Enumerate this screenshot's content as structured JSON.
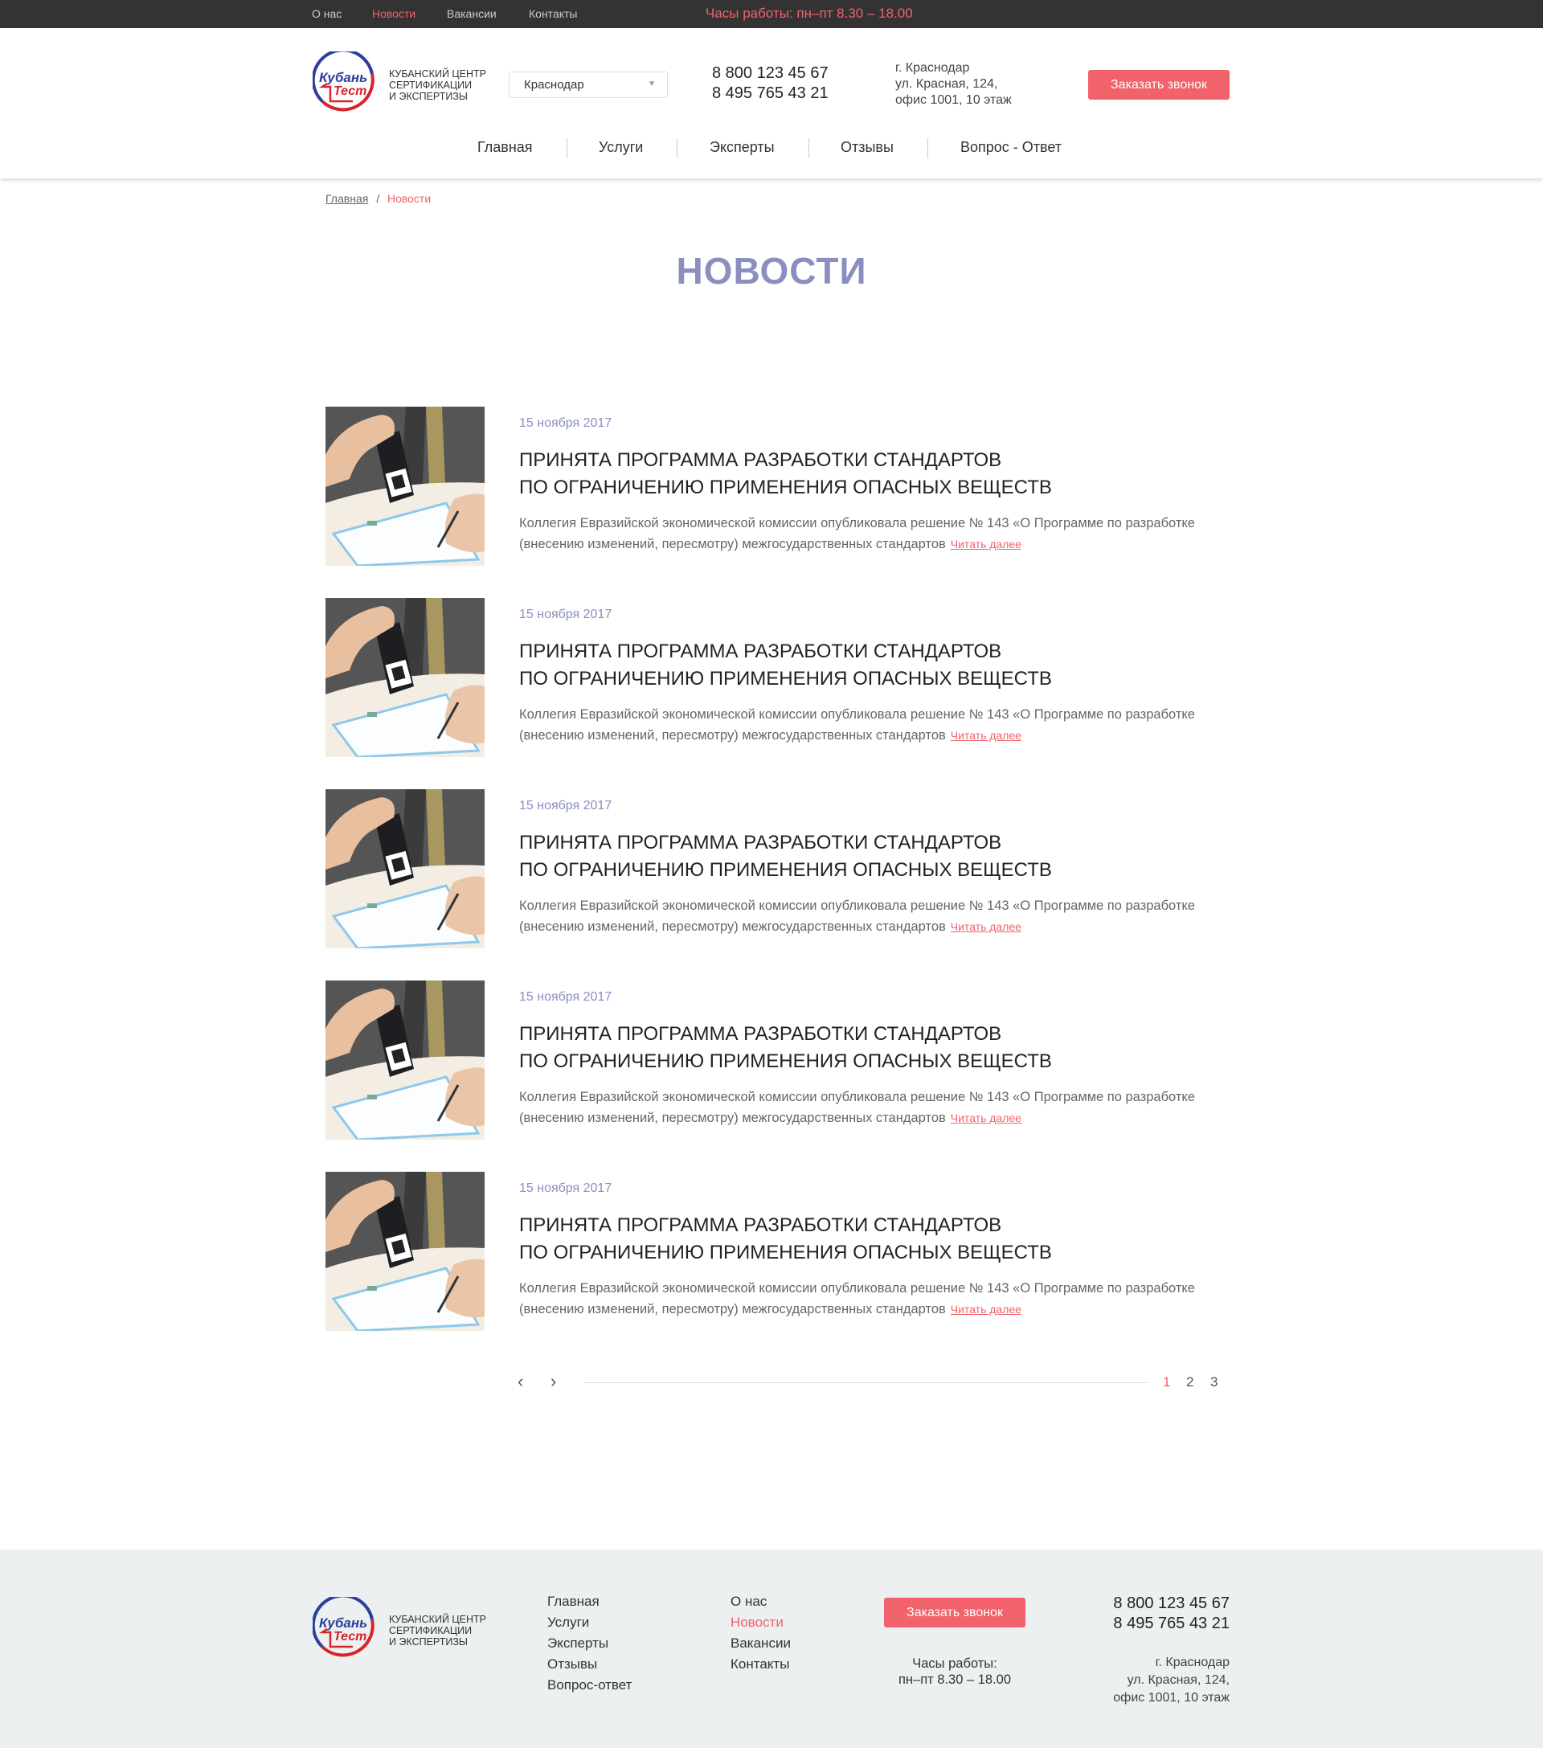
{
  "topbar": {
    "links": [
      {
        "label": "О нас",
        "active": false
      },
      {
        "label": "Новости",
        "active": true
      },
      {
        "label": "Вакансии",
        "active": false
      },
      {
        "label": "Контакты",
        "active": false
      }
    ],
    "hours": "Часы работы: пн–пт 8.30 – 18.00"
  },
  "header": {
    "logo_text": [
      "Кубанский центр",
      "сертификации",
      "и экспертизы"
    ],
    "logo_letters": [
      "Кубань",
      "Тест"
    ],
    "city": "Краснодар",
    "phones": [
      "8 800 123 45 67",
      "8 495 765 43 21"
    ],
    "address": [
      "г. Краснодар",
      "ул. Красная, 124,",
      "офис 1001, 10 этаж"
    ],
    "callback_label": "Заказать звонок"
  },
  "nav": [
    "Главная",
    "Услуги",
    "Эксперты",
    "Отзывы",
    "Вопрос - Ответ"
  ],
  "breadcrumb": {
    "home": "Главная",
    "separator": "/",
    "current": "Новости"
  },
  "page_title": "НОВОСТИ",
  "news": {
    "items": [
      {
        "date": "15 ноября 2017",
        "title1": "Принята программа разработки стандартов",
        "title2": "по ограничению применения опасных веществ",
        "desc": "Коллегия Евразийской экономической комиссии опубликовала решение № 143 «О Программе по разработке (внесению изменений, пересмотру) межгосударственных стандартов",
        "more": "Читать далее"
      },
      {
        "date": "15 ноября 2017",
        "title1": "Принята программа разработки стандартов",
        "title2": "по ограничению применения опасных веществ",
        "desc": "Коллегия Евразийской экономической комиссии опубликовала решение № 143 «О Программе по разработке (внесению изменений, пересмотру) межгосударственных стандартов",
        "more": "Читать далее"
      },
      {
        "date": "15 ноября 2017",
        "title1": "Принята программа разработки стандартов",
        "title2": "по ограничению применения опасных веществ",
        "desc": "Коллегия Евразийской экономической комиссии опубликовала решение № 143 «О Программе по разработке (внесению изменений, пересмотру) межгосударственных стандартов",
        "more": "Читать далее"
      },
      {
        "date": "15 ноября 2017",
        "title1": "Принята программа разработки стандартов",
        "title2": "по ограничению применения опасных веществ",
        "desc": "Коллегия Евразийской экономической комиссии опубликовала решение № 143 «О Программе по разработке (внесению изменений, пересмотру) межгосударственных стандартов",
        "more": "Читать далее"
      },
      {
        "date": "15 ноября 2017",
        "title1": "Принята программа разработки стандартов",
        "title2": "по ограничению применения опасных веществ",
        "desc": "Коллегия Евразийской экономической комиссии опубликовала решение № 143 «О Программе по разработке (внесению изменений, пересмотру) межгосударственных стандартов",
        "more": "Читать далее"
      }
    ]
  },
  "pagination": {
    "prev": "‹",
    "next": "›",
    "pages": [
      "1",
      "2",
      "3"
    ],
    "current": "1"
  },
  "footer": {
    "nav1": [
      "Главная",
      "Услуги",
      "Эксперты",
      "Отзывы",
      "Вопрос-ответ"
    ],
    "nav2": [
      "О нас",
      "Новости",
      "Вакансии",
      "Контакты"
    ],
    "nav2_active": "Новости",
    "callback_label": "Заказать звонок",
    "hours": [
      "Часы работы:",
      "пн–пт 8.30 – 18.00"
    ],
    "phones": [
      "8 800 123 45 67",
      "8 495 765 43 21"
    ],
    "address": [
      "г. Краснодар",
      "ул. Красная, 124,",
      "офис 1001, 10 этаж"
    ]
  },
  "colors": {
    "accent": "#f2626a",
    "title": "#8a8fbf",
    "topbar": "#333333",
    "footer_bg": "#edf0f0"
  }
}
